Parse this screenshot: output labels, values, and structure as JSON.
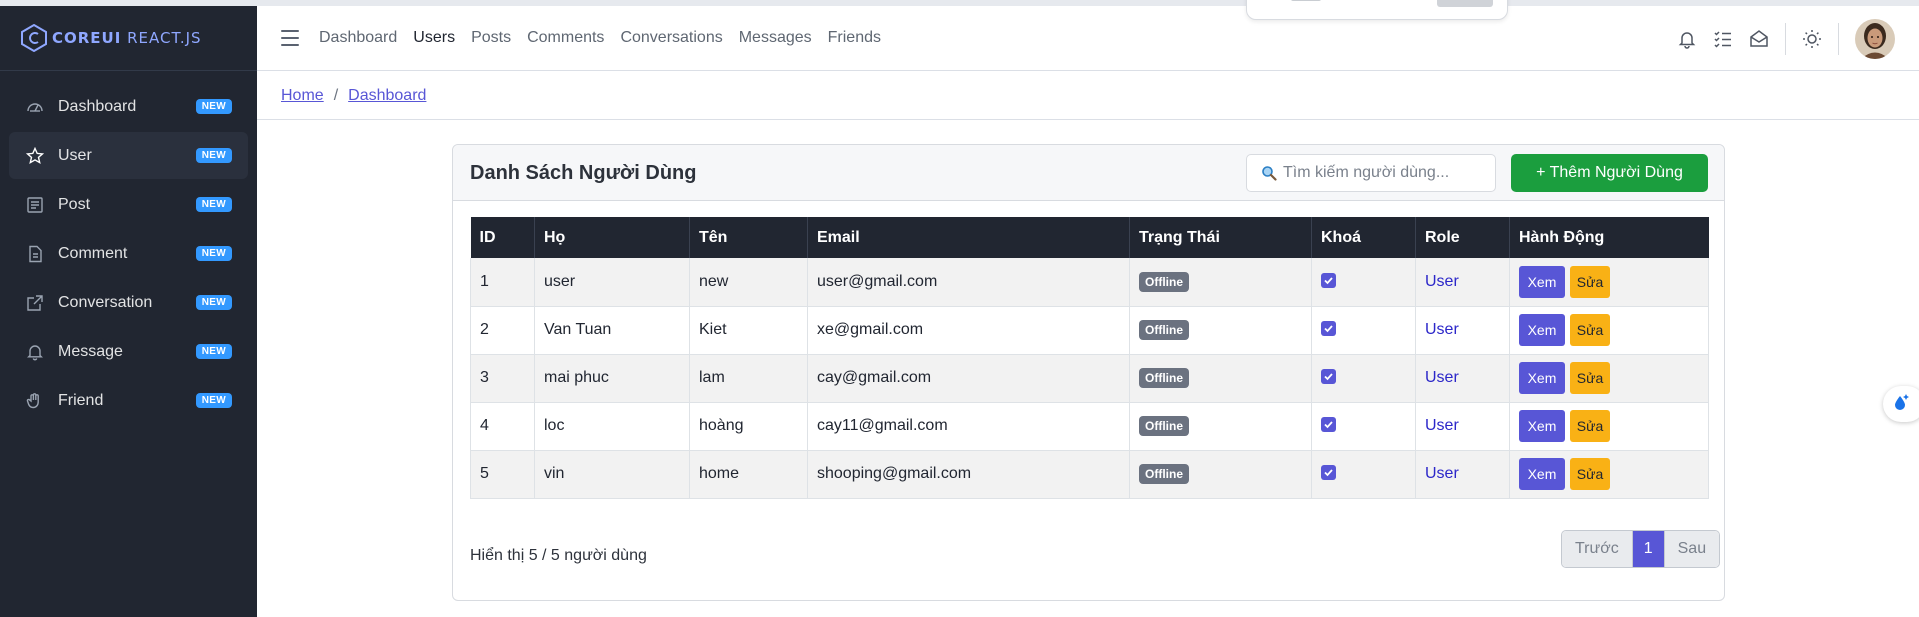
{
  "brand": {
    "name_bold": "COREUI",
    "name_light": "REACT.JS",
    "accent": "#8fa7ff"
  },
  "sidebar": {
    "items": [
      {
        "label": "Dashboard",
        "icon": "speedometer-icon",
        "badge": "NEW",
        "active": false
      },
      {
        "label": "User",
        "icon": "star-icon",
        "badge": "NEW",
        "active": true
      },
      {
        "label": "Post",
        "icon": "newspaper-icon",
        "badge": "NEW",
        "active": false
      },
      {
        "label": "Comment",
        "icon": "document-icon",
        "badge": "NEW",
        "active": false
      },
      {
        "label": "Conversation",
        "icon": "external-link-icon",
        "badge": "NEW",
        "active": false
      },
      {
        "label": "Message",
        "icon": "bell-icon",
        "badge": "NEW",
        "active": false
      },
      {
        "label": "Friend",
        "icon": "hand-icon",
        "badge": "NEW",
        "active": false
      }
    ]
  },
  "header": {
    "nav": [
      {
        "label": "Dashboard",
        "active": false
      },
      {
        "label": "Users",
        "active": true
      },
      {
        "label": "Posts",
        "active": false
      },
      {
        "label": "Comments",
        "active": false
      },
      {
        "label": "Conversations",
        "active": false
      },
      {
        "label": "Messages",
        "active": false
      },
      {
        "label": "Friends",
        "active": false
      }
    ],
    "icons": [
      "bell-icon",
      "task-list-icon",
      "envelope-open-icon",
      "sun-icon",
      "avatar"
    ]
  },
  "breadcrumb": {
    "home": "Home",
    "separator": "/",
    "current": "Dashboard"
  },
  "card": {
    "title": "Danh Sách Người Dùng",
    "search_placeholder": "Tìm kiếm người dùng...",
    "add_button": "+ Thêm Người Dùng"
  },
  "table": {
    "columns": [
      "ID",
      "Họ",
      "Tên",
      "Email",
      "Trạng Thái",
      "Khoá",
      "Role",
      "Hành Động"
    ],
    "rows": [
      {
        "id": "1",
        "last": "user",
        "first": "new",
        "email": "user@gmail.com",
        "status": "Offline",
        "locked": true,
        "role": "User"
      },
      {
        "id": "2",
        "last": "Van Tuan",
        "first": "Kiet",
        "email": "xe@gmail.com",
        "status": "Offline",
        "locked": true,
        "role": "User"
      },
      {
        "id": "3",
        "last": "mai phuc",
        "first": "lam",
        "email": "cay@gmail.com",
        "status": "Offline",
        "locked": true,
        "role": "User"
      },
      {
        "id": "4",
        "last": "loc",
        "first": "hoàng",
        "email": "cay11@gmail.com",
        "status": "Offline",
        "locked": true,
        "role": "User"
      },
      {
        "id": "5",
        "last": "vin",
        "first": "home",
        "email": "shooping@gmail.com",
        "status": "Offline",
        "locked": true,
        "role": "User"
      }
    ],
    "view_label": "Xem",
    "edit_label": "Sửa"
  },
  "footer": {
    "summary": "Hiển thị 5 / 5 người dùng",
    "prev": "Trước",
    "page": "1",
    "next": "Sau"
  },
  "colors": {
    "sidebar_bg": "#212631",
    "primary": "#5856d6",
    "success": "#1b9e3e",
    "warning": "#f9b115",
    "badge_new": "#3399ff",
    "status_offline": "#6b7280"
  }
}
